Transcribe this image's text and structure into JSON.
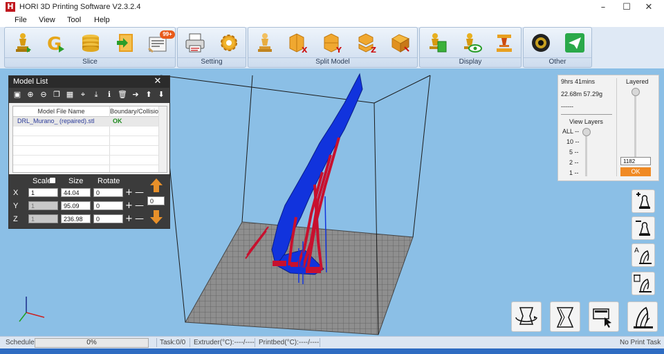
{
  "window": {
    "title": "HORI 3D Printing Software V2.3.2.4",
    "logo_letter": "H",
    "minimize": "–",
    "maximize": "☐",
    "close": "✕"
  },
  "menu": [
    "File",
    "View",
    "Tool",
    "Help"
  ],
  "ribbon": {
    "groups": [
      {
        "label": "Slice",
        "buttons": [
          "slice-chess-icon",
          "g-code-icon",
          "layers-stack-icon",
          "export-file-icon",
          "print-queue-icon"
        ],
        "badge": "99+"
      },
      {
        "label": "Setting",
        "buttons": [
          "printer-icon",
          "gear-icon"
        ]
      },
      {
        "label": "Split Model",
        "buttons": [
          "split-chess-icon",
          "split-x-icon",
          "split-y-icon",
          "split-z-icon",
          "split-angle-icon"
        ]
      },
      {
        "label": "Display",
        "buttons": [
          "display-model-icon",
          "display-eye-icon",
          "display-support-icon"
        ]
      },
      {
        "label": "Other",
        "buttons": [
          "camera-lens-icon",
          "send-icon"
        ]
      }
    ]
  },
  "model_list": {
    "title": "Model List",
    "close": "✕",
    "columns": [
      "Model File Name",
      "Boundary/Collision"
    ],
    "rows": [
      {
        "name": "DRL_Murano_ (repaired).stl",
        "status": "OK"
      }
    ],
    "transform": {
      "scale_label": "Scale",
      "size_label": "Size",
      "rotate_label": "Rotate",
      "axes": [
        {
          "axis": "X",
          "scale": "1",
          "size": "44.04",
          "rotate": "0"
        },
        {
          "axis": "Y",
          "scale": "1",
          "size": "95.09",
          "rotate": "0"
        },
        {
          "axis": "Z",
          "scale": "1",
          "size": "236.98",
          "rotate": "0"
        }
      ],
      "step_value": "0"
    }
  },
  "info_panel": {
    "time": "9hrs 41mins",
    "material": "22.68m 57.29g",
    "dashes": "------",
    "layered_label": "Layered",
    "view_layers_label": "View Layers",
    "levels": [
      "ALL --",
      "10 --",
      "5 --",
      "2 --",
      "1 --"
    ],
    "layer_value": "1182",
    "ok_label": "OK"
  },
  "status": {
    "schedule_label": "Schedule",
    "progress_text": "0%",
    "progress": 0,
    "task": "Task:0/0",
    "extruder": "Extruder(°C):----/----",
    "printbed": "Printbed(°C):----/----",
    "right": "No Print Task"
  },
  "colors": {
    "viewport_bg": "#8bbfe6",
    "model_blue": "#1133dd",
    "support_red": "#c8102e",
    "ok_orange": "#f08a24",
    "ok_green": "#1d8a1d"
  }
}
